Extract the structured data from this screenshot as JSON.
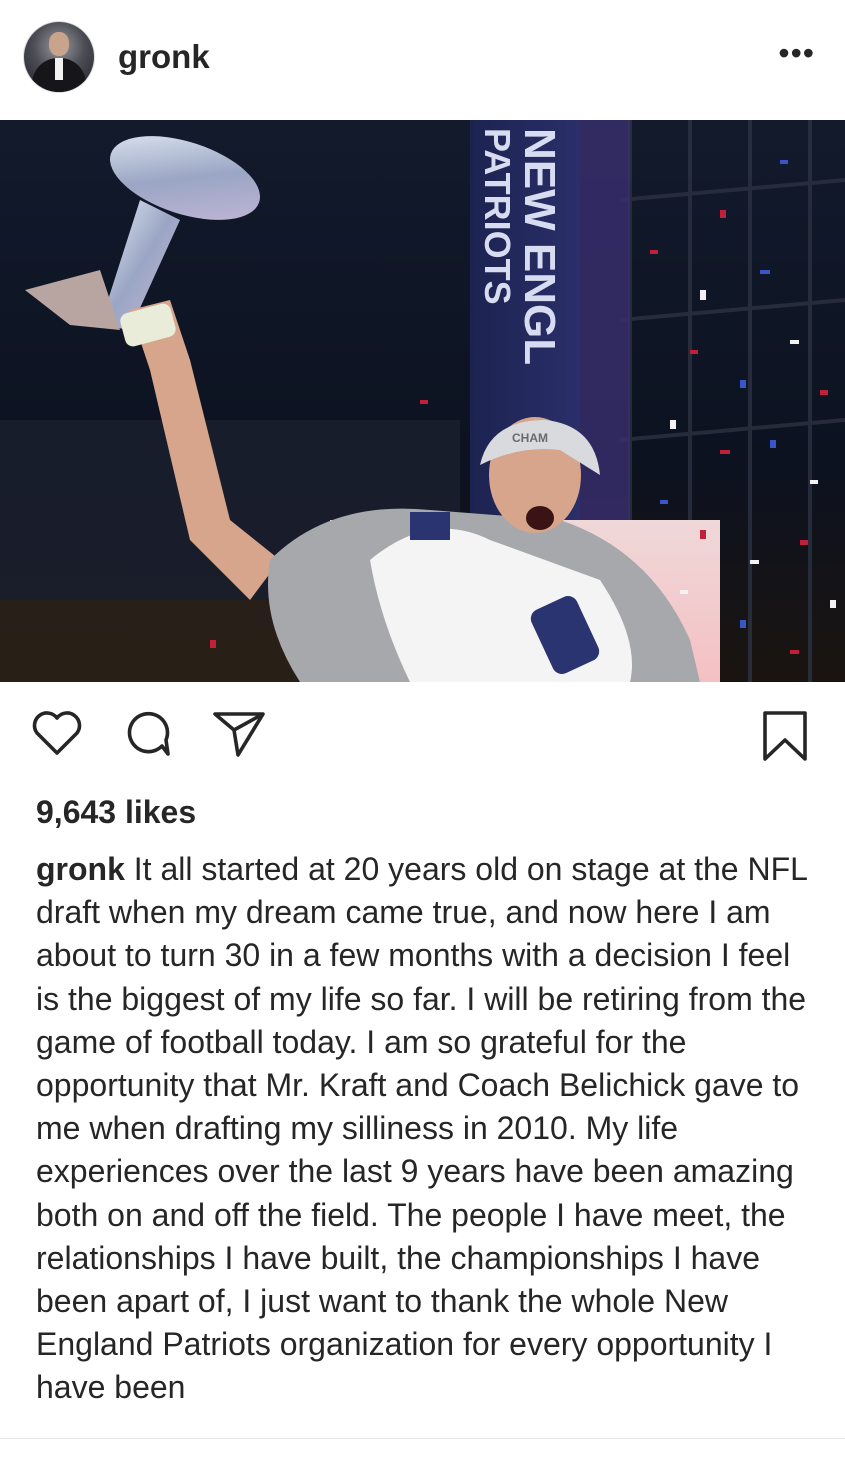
{
  "post": {
    "username": "gronk",
    "more_label": "•••",
    "likes_text": "9,643 likes",
    "caption_user": "gronk",
    "caption_text": "It all started at 20 years old on stage at the NFL draft when my dream came true, and now here I am about to turn 30 in a few months with a decision I feel is the biggest of my life so far. I will be retiring from the game of football today. I am so grateful for the opportunity that Mr. Kraft and Coach Belichick gave to me when drafting my silliness in 2010. My life experiences over the last 9 years have been amazing both on and off the field. The people I have meet, the relationships I have built, the championships I have been apart of, I just want to thank the whole New England Patriots organization for every opportunity I have been"
  },
  "photo": {
    "banner_text": "NEW ENGL",
    "banner_text2": "PATRIOTS",
    "cap_text": "CHAM"
  },
  "icons": {
    "avatar": "avatar-image",
    "more": "more-options-icon",
    "like": "heart-icon",
    "comment": "comment-bubble-icon",
    "share": "paper-plane-icon",
    "save": "bookmark-icon"
  },
  "colors": {
    "text": "#262626",
    "background": "#ffffff"
  }
}
